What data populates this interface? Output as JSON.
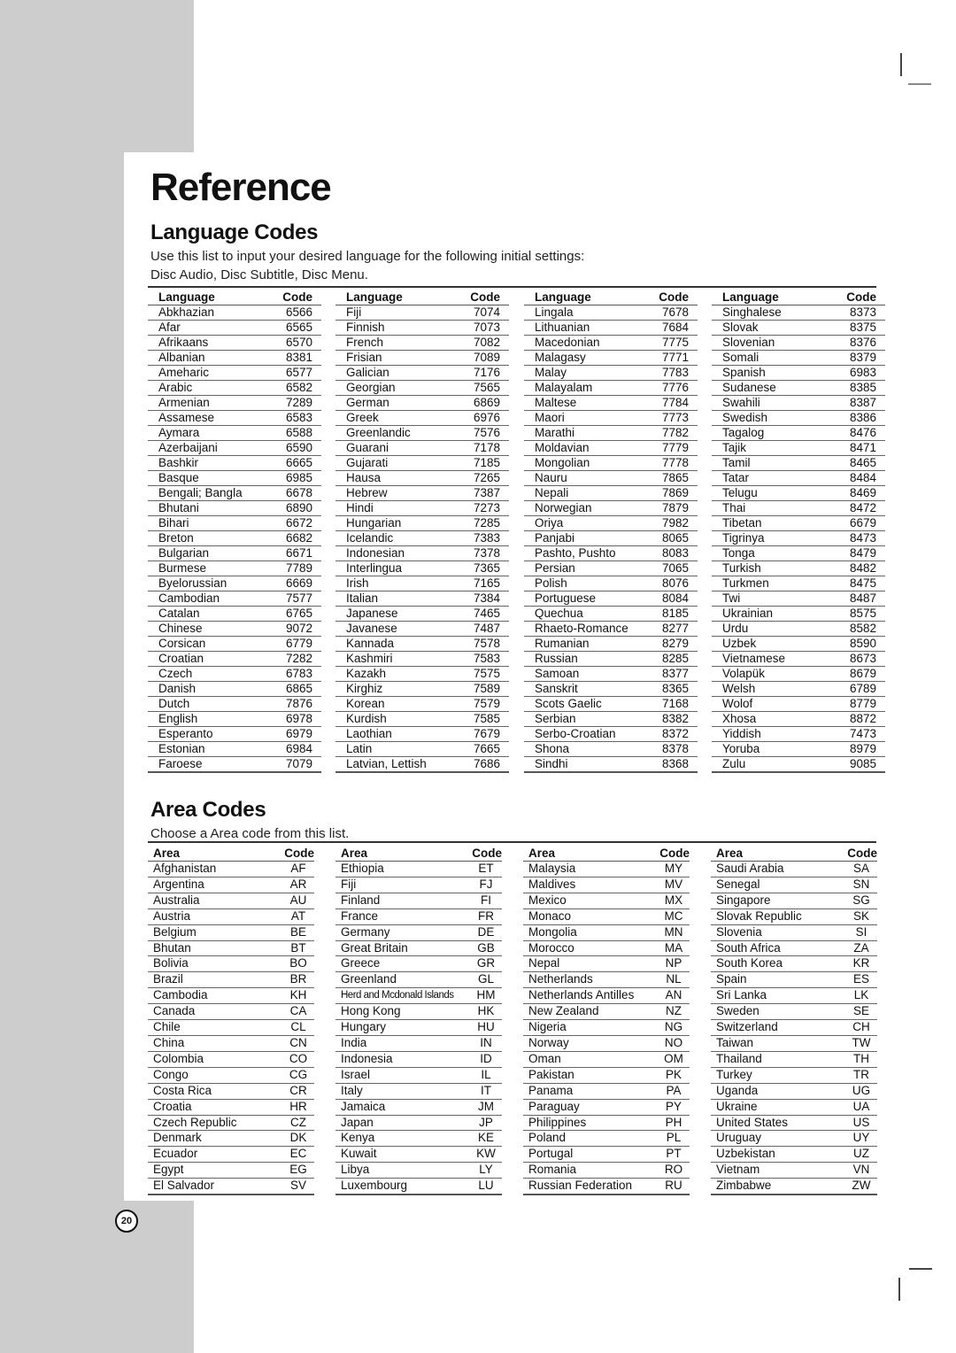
{
  "page": {
    "title": "Reference",
    "page_number": "20"
  },
  "language_codes": {
    "heading": "Language Codes",
    "intro_line1": "Use this list to input your desired language for the following initial settings:",
    "intro_line2": "Disc Audio, Disc Subtitle, Disc Menu.",
    "col_language": "Language",
    "col_code": "Code",
    "columns": [
      [
        [
          "Abkhazian",
          "6566"
        ],
        [
          "Afar",
          "6565"
        ],
        [
          "Afrikaans",
          "6570"
        ],
        [
          "Albanian",
          "8381"
        ],
        [
          "Ameharic",
          "6577"
        ],
        [
          "Arabic",
          "6582"
        ],
        [
          "Armenian",
          "7289"
        ],
        [
          "Assamese",
          "6583"
        ],
        [
          "Aymara",
          "6588"
        ],
        [
          "Azerbaijani",
          "6590"
        ],
        [
          "Bashkir",
          "6665"
        ],
        [
          "Basque",
          "6985"
        ],
        [
          "Bengali; Bangla",
          "6678"
        ],
        [
          "Bhutani",
          "6890"
        ],
        [
          "Bihari",
          "6672"
        ],
        [
          "Breton",
          "6682"
        ],
        [
          "Bulgarian",
          "6671"
        ],
        [
          "Burmese",
          "7789"
        ],
        [
          "Byelorussian",
          "6669"
        ],
        [
          "Cambodian",
          "7577"
        ],
        [
          "Catalan",
          "6765"
        ],
        [
          "Chinese",
          "9072"
        ],
        [
          "Corsican",
          "6779"
        ],
        [
          "Croatian",
          "7282"
        ],
        [
          "Czech",
          "6783"
        ],
        [
          "Danish",
          "6865"
        ],
        [
          "Dutch",
          "7876"
        ],
        [
          "English",
          "6978"
        ],
        [
          "Esperanto",
          "6979"
        ],
        [
          "Estonian",
          "6984"
        ],
        [
          "Faroese",
          "7079"
        ]
      ],
      [
        [
          "Fiji",
          "7074"
        ],
        [
          "Finnish",
          "7073"
        ],
        [
          "French",
          "7082"
        ],
        [
          "Frisian",
          "7089"
        ],
        [
          "Galician",
          "7176"
        ],
        [
          "Georgian",
          "7565"
        ],
        [
          "German",
          "6869"
        ],
        [
          "Greek",
          "6976"
        ],
        [
          "Greenlandic",
          "7576"
        ],
        [
          "Guarani",
          "7178"
        ],
        [
          "Gujarati",
          "7185"
        ],
        [
          "Hausa",
          "7265"
        ],
        [
          "Hebrew",
          "7387"
        ],
        [
          "Hindi",
          "7273"
        ],
        [
          "Hungarian",
          "7285"
        ],
        [
          "Icelandic",
          "7383"
        ],
        [
          "Indonesian",
          "7378"
        ],
        [
          "Interlingua",
          "7365"
        ],
        [
          "Irish",
          "7165"
        ],
        [
          "Italian",
          "7384"
        ],
        [
          "Japanese",
          "7465"
        ],
        [
          "Javanese",
          "7487"
        ],
        [
          "Kannada",
          "7578"
        ],
        [
          "Kashmiri",
          "7583"
        ],
        [
          "Kazakh",
          "7575"
        ],
        [
          "Kirghiz",
          "7589"
        ],
        [
          "Korean",
          "7579"
        ],
        [
          "Kurdish",
          "7585"
        ],
        [
          "Laothian",
          "7679"
        ],
        [
          "Latin",
          "7665"
        ],
        [
          "Latvian, Lettish",
          "7686"
        ]
      ],
      [
        [
          "Lingala",
          "7678"
        ],
        [
          "Lithuanian",
          "7684"
        ],
        [
          "Macedonian",
          "7775"
        ],
        [
          "Malagasy",
          "7771"
        ],
        [
          "Malay",
          "7783"
        ],
        [
          "Malayalam",
          "7776"
        ],
        [
          "Maltese",
          "7784"
        ],
        [
          "Maori",
          "7773"
        ],
        [
          "Marathi",
          "7782"
        ],
        [
          "Moldavian",
          "7779"
        ],
        [
          "Mongolian",
          "7778"
        ],
        [
          "Nauru",
          "7865"
        ],
        [
          "Nepali",
          "7869"
        ],
        [
          "Norwegian",
          "7879"
        ],
        [
          "Oriya",
          "7982"
        ],
        [
          "Panjabi",
          "8065"
        ],
        [
          "Pashto, Pushto",
          "8083"
        ],
        [
          "Persian",
          "7065"
        ],
        [
          "Polish",
          "8076"
        ],
        [
          "Portuguese",
          "8084"
        ],
        [
          "Quechua",
          "8185"
        ],
        [
          "Rhaeto-Romance",
          "8277"
        ],
        [
          "Rumanian",
          "8279"
        ],
        [
          "Russian",
          "8285"
        ],
        [
          "Samoan",
          "8377"
        ],
        [
          "Sanskrit",
          "8365"
        ],
        [
          "Scots Gaelic",
          "7168"
        ],
        [
          "Serbian",
          "8382"
        ],
        [
          "Serbo-Croatian",
          "8372"
        ],
        [
          "Shona",
          "8378"
        ],
        [
          "Sindhi",
          "8368"
        ]
      ],
      [
        [
          "Singhalese",
          "8373"
        ],
        [
          "Slovak",
          "8375"
        ],
        [
          "Slovenian",
          "8376"
        ],
        [
          "Somali",
          "8379"
        ],
        [
          "Spanish",
          "6983"
        ],
        [
          "Sudanese",
          "8385"
        ],
        [
          "Swahili",
          "8387"
        ],
        [
          "Swedish",
          "8386"
        ],
        [
          "Tagalog",
          "8476"
        ],
        [
          "Tajik",
          "8471"
        ],
        [
          "Tamil",
          "8465"
        ],
        [
          "Tatar",
          "8484"
        ],
        [
          "Telugu",
          "8469"
        ],
        [
          "Thai",
          "8472"
        ],
        [
          "Tibetan",
          "6679"
        ],
        [
          "Tigrinya",
          "8473"
        ],
        [
          "Tonga",
          "8479"
        ],
        [
          "Turkish",
          "8482"
        ],
        [
          "Turkmen",
          "8475"
        ],
        [
          "Twi",
          "8487"
        ],
        [
          "Ukrainian",
          "8575"
        ],
        [
          "Urdu",
          "8582"
        ],
        [
          "Uzbek",
          "8590"
        ],
        [
          "Vietnamese",
          "8673"
        ],
        [
          "Volapük",
          "8679"
        ],
        [
          "Welsh",
          "6789"
        ],
        [
          "Wolof",
          "8779"
        ],
        [
          "Xhosa",
          "8872"
        ],
        [
          "Yiddish",
          "7473"
        ],
        [
          "Yoruba",
          "8979"
        ],
        [
          "Zulu",
          "9085"
        ]
      ]
    ]
  },
  "area_codes": {
    "heading": "Area Codes",
    "intro": "Choose a Area code from this list.",
    "col_area": "Area",
    "col_code": "Code",
    "columns": [
      [
        [
          "Afghanistan",
          "AF"
        ],
        [
          "Argentina",
          "AR"
        ],
        [
          "Australia",
          "AU"
        ],
        [
          "Austria",
          "AT"
        ],
        [
          "Belgium",
          "BE"
        ],
        [
          "Bhutan",
          "BT"
        ],
        [
          "Bolivia",
          "BO"
        ],
        [
          "Brazil",
          "BR"
        ],
        [
          "Cambodia",
          "KH"
        ],
        [
          "Canada",
          "CA"
        ],
        [
          "Chile",
          "CL"
        ],
        [
          "China",
          "CN"
        ],
        [
          "Colombia",
          "CO"
        ],
        [
          "Congo",
          "CG"
        ],
        [
          "Costa Rica",
          "CR"
        ],
        [
          "Croatia",
          "HR"
        ],
        [
          "Czech Republic",
          "CZ"
        ],
        [
          "Denmark",
          "DK"
        ],
        [
          "Ecuador",
          "EC"
        ],
        [
          "Egypt",
          "EG"
        ],
        [
          "El Salvador",
          "SV"
        ]
      ],
      [
        [
          "Ethiopia",
          "ET"
        ],
        [
          "Fiji",
          "FJ"
        ],
        [
          "Finland",
          "FI"
        ],
        [
          "France",
          "FR"
        ],
        [
          "Germany",
          "DE"
        ],
        [
          "Great Britain",
          "GB"
        ],
        [
          "Greece",
          "GR"
        ],
        [
          "Greenland",
          "GL"
        ],
        [
          "Herd and Mcdonald Islands",
          "HM"
        ],
        [
          "Hong Kong",
          "HK"
        ],
        [
          "Hungary",
          "HU"
        ],
        [
          "India",
          "IN"
        ],
        [
          "Indonesia",
          "ID"
        ],
        [
          "Israel",
          "IL"
        ],
        [
          "Italy",
          "IT"
        ],
        [
          "Jamaica",
          "JM"
        ],
        [
          "Japan",
          "JP"
        ],
        [
          "Kenya",
          "KE"
        ],
        [
          "Kuwait",
          "KW"
        ],
        [
          "Libya",
          "LY"
        ],
        [
          "Luxembourg",
          "LU"
        ]
      ],
      [
        [
          "Malaysia",
          "MY"
        ],
        [
          "Maldives",
          "MV"
        ],
        [
          "Mexico",
          "MX"
        ],
        [
          "Monaco",
          "MC"
        ],
        [
          "Mongolia",
          "MN"
        ],
        [
          "Morocco",
          "MA"
        ],
        [
          "Nepal",
          "NP"
        ],
        [
          "Netherlands",
          "NL"
        ],
        [
          "Netherlands Antilles",
          "AN"
        ],
        [
          "New Zealand",
          "NZ"
        ],
        [
          "Nigeria",
          "NG"
        ],
        [
          "Norway",
          "NO"
        ],
        [
          "Oman",
          "OM"
        ],
        [
          "Pakistan",
          "PK"
        ],
        [
          "Panama",
          "PA"
        ],
        [
          "Paraguay",
          "PY"
        ],
        [
          "Philippines",
          "PH"
        ],
        [
          "Poland",
          "PL"
        ],
        [
          "Portugal",
          "PT"
        ],
        [
          "Romania",
          "RO"
        ],
        [
          "Russian Federation",
          "RU"
        ]
      ],
      [
        [
          "Saudi Arabia",
          "SA"
        ],
        [
          "Senegal",
          "SN"
        ],
        [
          "Singapore",
          "SG"
        ],
        [
          "Slovak Republic",
          "SK"
        ],
        [
          "Slovenia",
          "SI"
        ],
        [
          "South Africa",
          "ZA"
        ],
        [
          "South Korea",
          "KR"
        ],
        [
          "Spain",
          "ES"
        ],
        [
          "Sri Lanka",
          "LK"
        ],
        [
          "Sweden",
          "SE"
        ],
        [
          "Switzerland",
          "CH"
        ],
        [
          "Taiwan",
          "TW"
        ],
        [
          "Thailand",
          "TH"
        ],
        [
          "Turkey",
          "TR"
        ],
        [
          "Uganda",
          "UG"
        ],
        [
          "Ukraine",
          "UA"
        ],
        [
          "United States",
          "US"
        ],
        [
          "Uruguay",
          "UY"
        ],
        [
          "Uzbekistan",
          "UZ"
        ],
        [
          "Vietnam",
          "VN"
        ],
        [
          "Zimbabwe",
          "ZW"
        ]
      ]
    ]
  }
}
